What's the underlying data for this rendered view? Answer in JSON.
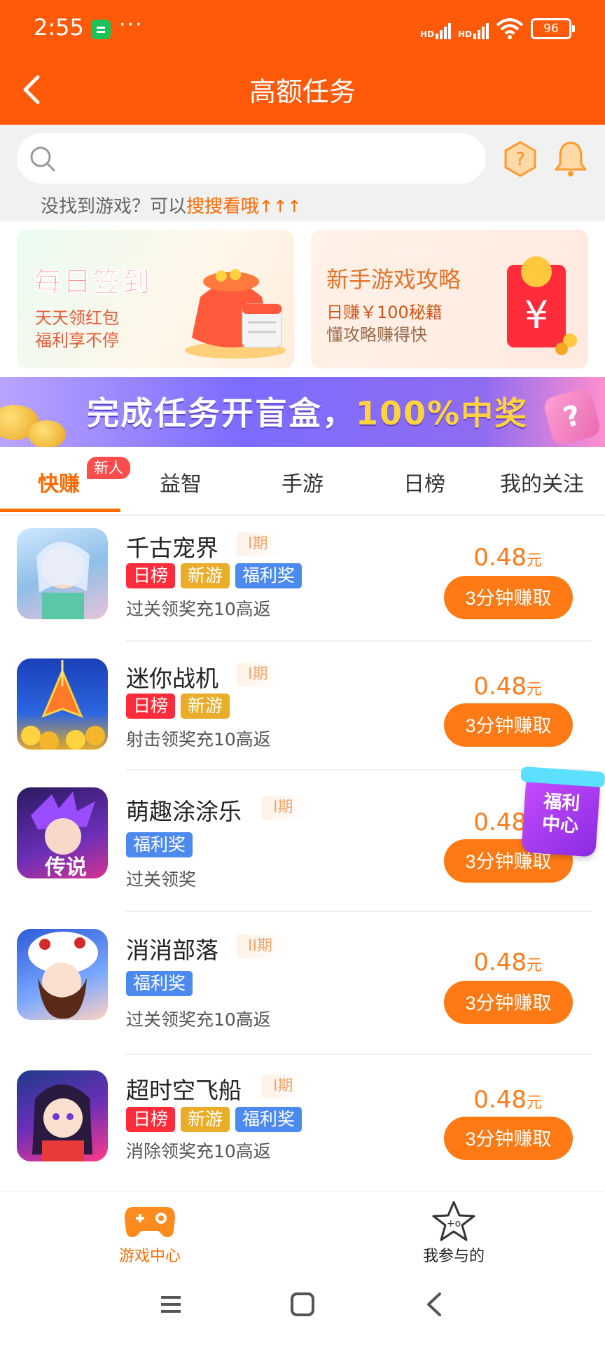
{
  "status_bar": {
    "time": "2:55",
    "dots": "···",
    "signal1": "HD",
    "signal2": "HD",
    "battery": "96"
  },
  "header": {
    "title": "高额任务"
  },
  "search": {
    "placeholder": "",
    "hint_prefix": "没找到游戏？可以",
    "hint_link": "搜搜看哦",
    "hint_arrows": "↑↑↑"
  },
  "promos": [
    {
      "title": "每日签到",
      "line1": "天天领红包",
      "line2": "福利享不停"
    },
    {
      "title": "新手游戏攻略",
      "line1": "日赚￥100秘籍",
      "line2": "懂攻略赚得快"
    }
  ],
  "banner": {
    "text_main": "完成任务开盲盒，",
    "text_highlight": "100%中奖",
    "box_mark": "?"
  },
  "tabs": [
    {
      "label": "快赚",
      "badge": "新人",
      "active": true
    },
    {
      "label": "益智"
    },
    {
      "label": "手游"
    },
    {
      "label": "日榜"
    },
    {
      "label": "我的关注"
    }
  ],
  "games": [
    {
      "name": "千古宠界",
      "period": "I期",
      "tags": [
        "日榜",
        "新游",
        "福利奖"
      ],
      "desc": "过关领奖充10高返",
      "reward": "0.48",
      "unit": "元",
      "button": "3分钟赚取"
    },
    {
      "name": "迷你战机",
      "period": "I期",
      "tags": [
        "日榜",
        "新游"
      ],
      "desc": "射击领奖充10高返",
      "reward": "0.48",
      "unit": "元",
      "button": "3分钟赚取"
    },
    {
      "name": "萌趣涂涂乐",
      "period": "I期",
      "tags": [
        "福利奖"
      ],
      "desc": "过关领奖",
      "reward": "0.48",
      "unit": "元",
      "button": "3分钟赚取"
    },
    {
      "name": "消消部落",
      "period": "II期",
      "tags": [
        "福利奖"
      ],
      "desc": "过关领奖充10高返",
      "reward": "0.48",
      "unit": "元",
      "button": "3分钟赚取"
    },
    {
      "name": "超时空飞船",
      "period": "I期",
      "tags": [
        "日榜",
        "新游",
        "福利奖"
      ],
      "desc": "消除领奖充10高返",
      "reward": "0.48",
      "unit": "元",
      "button": "3分钟赚取"
    }
  ],
  "game_icon_texts": {
    "icon3_caption": "传说"
  },
  "float_widget": {
    "line1": "福利",
    "line2": "中心"
  },
  "bottom_nav": [
    {
      "label": "游戏中心",
      "active": true,
      "icon": "gamepad-icon"
    },
    {
      "label": "我参与的",
      "active": false,
      "icon": "star-icon"
    }
  ],
  "colors": {
    "brand": "#ff5a0a",
    "accent": "#ff7a14",
    "tag_red": "#ff2d3c",
    "tag_gold": "#e9ad2a",
    "tag_blue": "#4d8af0"
  }
}
